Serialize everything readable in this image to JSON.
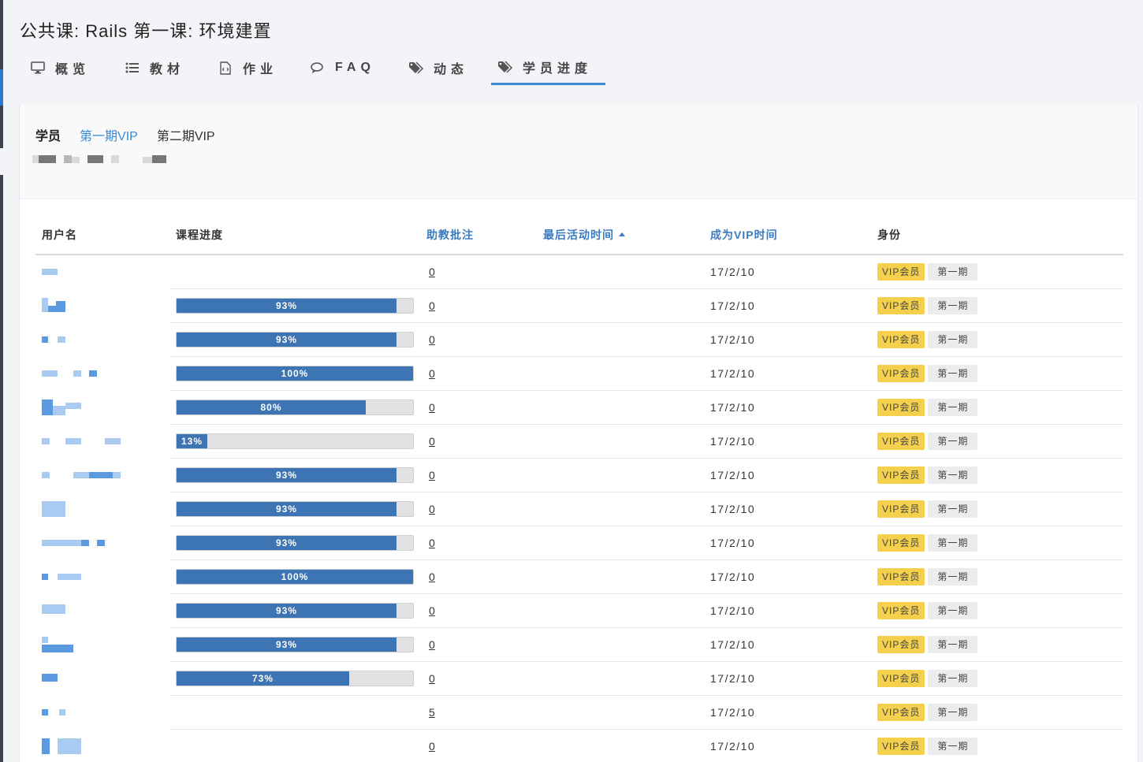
{
  "page": {
    "title": "公共课: Rails 第一课: 环境建置"
  },
  "tabs": [
    {
      "label": "概览",
      "icon": "monitor-icon"
    },
    {
      "label": "教材",
      "icon": "list-icon"
    },
    {
      "label": "作业",
      "icon": "file-code-icon"
    },
    {
      "label": "FAQ",
      "icon": "chat-icon"
    },
    {
      "label": "动态",
      "icon": "tags-icon"
    },
    {
      "label": "学员进度",
      "icon": "tags-icon",
      "active": true
    }
  ],
  "groups": {
    "title": "学员",
    "items": [
      "第一期VIP",
      "第二期VIP"
    ],
    "selected": "第一期VIP"
  },
  "table": {
    "headers": {
      "username": "用户名",
      "progress": "课程进度",
      "notes": "助教批注",
      "last_active": "最后活动时间",
      "vip_since": "成为VIP时间",
      "role": "身份"
    },
    "rows": [
      {
        "progress": null,
        "notes": "0",
        "vip_since": "17/2/10",
        "badges": [
          "VIP会员",
          "第一期"
        ]
      },
      {
        "progress": 93,
        "progress_label": "93%",
        "notes": "0",
        "vip_since": "17/2/10",
        "badges": [
          "VIP会员",
          "第一期"
        ]
      },
      {
        "progress": 93,
        "progress_label": "93%",
        "notes": "0",
        "vip_since": "17/2/10",
        "badges": [
          "VIP会员",
          "第一期"
        ]
      },
      {
        "progress": 100,
        "progress_label": "100%",
        "notes": "0",
        "vip_since": "17/2/10",
        "badges": [
          "VIP会员",
          "第一期"
        ]
      },
      {
        "progress": 80,
        "progress_label": "80%",
        "notes": "0",
        "vip_since": "17/2/10",
        "badges": [
          "VIP会员",
          "第一期"
        ]
      },
      {
        "progress": 13,
        "progress_label": "13%",
        "notes": "0",
        "vip_since": "17/2/10",
        "badges": [
          "VIP会员",
          "第一期"
        ]
      },
      {
        "progress": 93,
        "progress_label": "93%",
        "notes": "0",
        "vip_since": "17/2/10",
        "badges": [
          "VIP会员",
          "第一期"
        ]
      },
      {
        "progress": 93,
        "progress_label": "93%",
        "notes": "0",
        "vip_since": "17/2/10",
        "badges": [
          "VIP会员",
          "第一期"
        ]
      },
      {
        "progress": 93,
        "progress_label": "93%",
        "notes": "0",
        "vip_since": "17/2/10",
        "badges": [
          "VIP会员",
          "第一期"
        ]
      },
      {
        "progress": 100,
        "progress_label": "100%",
        "notes": "0",
        "vip_since": "17/2/10",
        "badges": [
          "VIP会员",
          "第一期"
        ]
      },
      {
        "progress": 93,
        "progress_label": "93%",
        "notes": "0",
        "vip_since": "17/2/10",
        "badges": [
          "VIP会员",
          "第一期"
        ]
      },
      {
        "progress": 93,
        "progress_label": "93%",
        "notes": "0",
        "vip_since": "17/2/10",
        "badges": [
          "VIP会员",
          "第一期"
        ]
      },
      {
        "progress": 73,
        "progress_label": "73%",
        "notes": "0",
        "vip_since": "17/2/10",
        "badges": [
          "VIP会员",
          "第一期"
        ]
      },
      {
        "progress": null,
        "notes": "5",
        "vip_since": "17/2/10",
        "badges": [
          "VIP会员",
          "第一期"
        ]
      },
      {
        "progress": null,
        "notes": "0",
        "vip_since": "17/2/10",
        "badges": [
          "VIP会员",
          "第一期"
        ]
      }
    ]
  },
  "colors": {
    "accent": "#3a8bd6",
    "progress_fill": "#3d74b4",
    "vip_badge": "#f4d04d",
    "period_badge": "#ececec"
  }
}
